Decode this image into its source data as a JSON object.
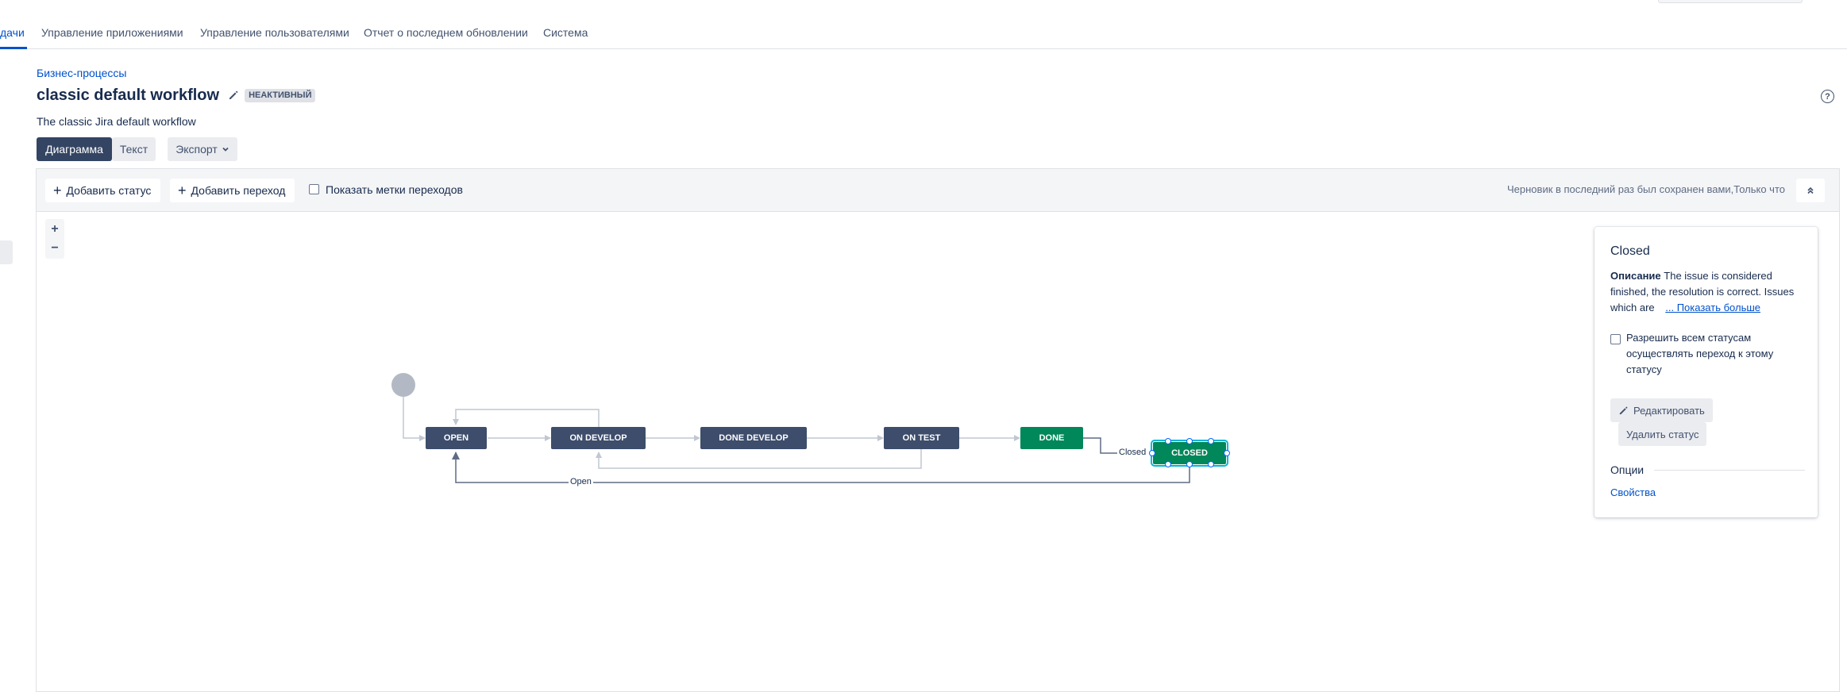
{
  "nav": {
    "tabs": [
      {
        "label": "дачи",
        "active": true
      },
      {
        "label": "Управление приложениями"
      },
      {
        "label": "Управление пользователями"
      },
      {
        "label": "Отчет о последнем обновлении"
      },
      {
        "label": "Система"
      }
    ]
  },
  "header": {
    "breadcrumb": "Бизнес-процессы",
    "title": "classic default workflow",
    "status_badge": "НЕАКТИВНЫЙ",
    "description": "The classic Jira default workflow",
    "help_icon": "?"
  },
  "view": {
    "diagram_label": "Диаграмма",
    "text_label": "Текст",
    "export_label": "Экспорт"
  },
  "toolbar": {
    "add_status_label": "Добавить статус",
    "add_transition_label": "Добавить переход",
    "show_labels_label": "Показать метки переходов",
    "show_labels_checked": false,
    "draft_text": "Черновик в последний раз был сохранен вами,Только что"
  },
  "zoom": {
    "in": "+",
    "out": "−"
  },
  "diagram": {
    "statuses": [
      {
        "id": "open",
        "label": "OPEN",
        "color": "#3d4d6b"
      },
      {
        "id": "on_develop",
        "label": "ON DEVELOP",
        "color": "#3d4d6b"
      },
      {
        "id": "done_develop",
        "label": "DONE DEVELOP",
        "color": "#3d4d6b"
      },
      {
        "id": "on_test",
        "label": "ON TEST",
        "color": "#3d4d6b"
      },
      {
        "id": "done",
        "label": "DONE",
        "color": "#00875a"
      },
      {
        "id": "closed",
        "label": "CLOSED",
        "color": "#00875a",
        "selected": true
      }
    ],
    "transition_labels": {
      "closed": "Closed",
      "open": "Open"
    }
  },
  "panel": {
    "title": "Closed",
    "desc_label": "Описание",
    "desc_text": "The issue is considered finished, the resolution is correct. Issues which are",
    "show_more": "... Показать больше",
    "allow_all_label": "Разрешить всем статусам осуществлять переход к этому статусу",
    "allow_all_checked": false,
    "edit_label": "Редактировать",
    "delete_label": "Удалить статус",
    "options_label": "Опции",
    "properties_label": "Свойства"
  },
  "colors": {
    "accent": "#0052cc",
    "status_dark": "#3d4d6b",
    "status_green": "#00875a",
    "selection": "#00b8d9"
  }
}
